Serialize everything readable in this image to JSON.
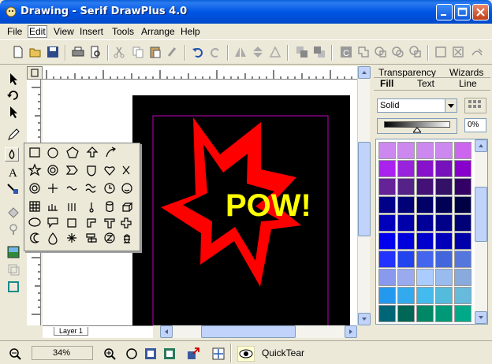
{
  "window": {
    "title": "Drawing - Serif DrawPlus 4.0"
  },
  "menu": [
    "File",
    "Edit",
    "View",
    "Insert",
    "Tools",
    "Arrange",
    "Help"
  ],
  "active_menu": "Edit",
  "toolbar_icons": [
    "new-icon",
    "open-icon",
    "save-icon",
    "print-icon",
    "print-preview-icon",
    "cut-icon",
    "copy-icon",
    "paste-icon",
    "format-painter-icon",
    "undo-icon",
    "redo-icon",
    "flip-horizontal-icon",
    "flip-vertical-icon",
    "rotate-icon",
    "bring-to-front-icon",
    "send-to-back-icon",
    "convert-to-curves-icon",
    "combine-icon",
    "add-icon",
    "subtract-icon",
    "intersect-icon",
    "group-icon",
    "ungroup-icon",
    "split-icon"
  ],
  "left_tools": [
    "pointer-icon",
    "rotate-tool-icon",
    "node-tool-icon",
    "pencil-icon",
    "quickshapes-icon",
    "text-icon",
    "connector-icon",
    "fill-tool-icon",
    "transparency-tool-icon",
    "image-icon",
    "envelope-icon",
    "crop-icon"
  ],
  "flyout_shapes": [
    "rectangle",
    "ellipse",
    "pentagon",
    "up-arrow",
    "curved-arrow",
    "star",
    "donut",
    "chevron",
    "shield",
    "heart",
    "scissors",
    "spiral",
    "petal",
    "wave",
    "double-wave",
    "clock",
    "smiley",
    "grid",
    "ruler",
    "bars",
    "thermometer",
    "cylinder",
    "cube",
    "speech-bubble",
    "callout",
    "trapezoid",
    "corner",
    "tee",
    "cross",
    "moon",
    "drop",
    "burst",
    "signpost",
    "zeta",
    "bug"
  ],
  "artwork": {
    "text": "POW!",
    "text_color": "#ffff00",
    "star_color": "#ff0000",
    "page_color": "#000000",
    "margin_color": "#c000c0"
  },
  "layer": "Layer 1",
  "panel": {
    "top_tabs": [
      "Transparency",
      "Wizards"
    ],
    "bottom_tabs": [
      "Fill",
      "Text",
      "Line"
    ],
    "active_tab": "Fill",
    "fill_type": "Solid",
    "percent": "0%",
    "swatch_colors": [
      [
        "#cc88ee",
        "#cc88ee",
        "#cc88ee",
        "#cc88ee",
        "#cc66ee"
      ],
      [
        "#aa22ee",
        "#9922dd",
        "#8811cc",
        "#7711bb",
        "#8800cc"
      ],
      [
        "#662299",
        "#552288",
        "#441177",
        "#331166",
        "#330066"
      ],
      [
        "#000088",
        "#000077",
        "#000066",
        "#000055",
        "#000044"
      ],
      [
        "#0000bb",
        "#0000aa",
        "#000099",
        "#000088",
        "#000077"
      ],
      [
        "#0000ee",
        "#0000dd",
        "#0000cc",
        "#0000bb",
        "#0000aa"
      ],
      [
        "#2233ff",
        "#2244ee",
        "#4466ee",
        "#4466dd",
        "#5577dd"
      ],
      [
        "#8899ee",
        "#99aaee",
        "#aaccff",
        "#99bbee",
        "#88aadd"
      ],
      [
        "#2299ee",
        "#33aaee",
        "#44bbee",
        "#55bbdd",
        "#66bbdd"
      ],
      [
        "#006677",
        "#006655",
        "#008866",
        "#009977",
        "#00aa88"
      ]
    ]
  },
  "status": {
    "zoom": "34%",
    "tip": "QuickTear"
  }
}
